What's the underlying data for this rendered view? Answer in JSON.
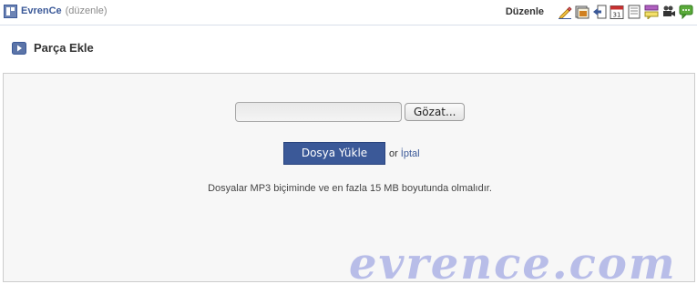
{
  "header": {
    "brand_name": "EvrenCe",
    "brand_edit": "(düzenle)",
    "toolbar_label": "Düzenle",
    "toolbar_icons": [
      "pencil-icon",
      "photo-album-icon",
      "export-icon",
      "calendar-icon",
      "document-icon",
      "comment-list-icon",
      "video-camera-icon",
      "chat-bubble-icon"
    ],
    "calendar_day": "31"
  },
  "section": {
    "title": "Parça Ekle"
  },
  "upload": {
    "file_value": "",
    "browse_label": "Gözat...",
    "submit_label": "Dosya Yükle",
    "or_text": "or",
    "cancel_label": "İptal",
    "note": "Dosyalar MP3 biçiminde ve en fazla 15 MB boyutunda olmalıdır."
  },
  "watermark": "evrence.com",
  "colors": {
    "brand": "#3b5998",
    "panel_bg": "#f7f7f7",
    "watermark": "#b8bde8"
  }
}
